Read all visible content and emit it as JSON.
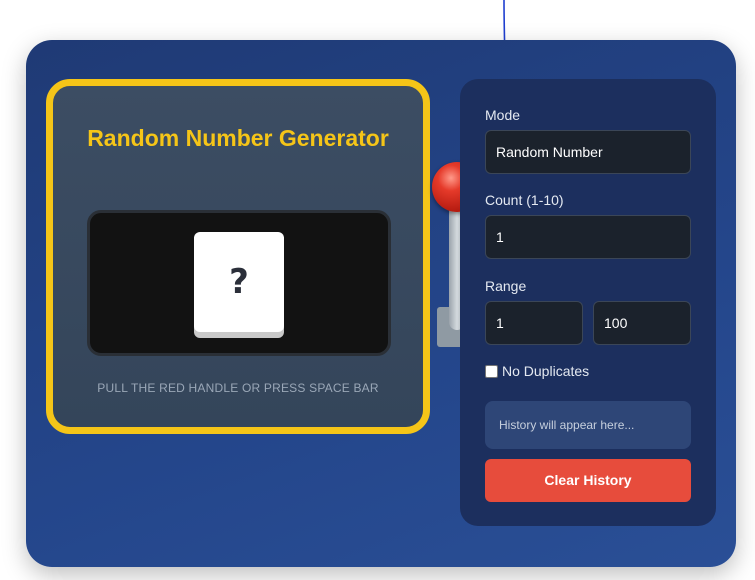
{
  "machine": {
    "title": "Random Number Generator",
    "result": "?",
    "hint": "PULL THE RED HANDLE OR PRESS SPACE BAR"
  },
  "controls": {
    "mode_label": "Mode",
    "mode_value": "Random Number",
    "count_label": "Count (1-10)",
    "count_value": "1",
    "range_label": "Range",
    "range_min": "1",
    "range_max": "100",
    "no_duplicates_label": "No Duplicates",
    "no_duplicates_checked": false,
    "history_placeholder": "History will appear here...",
    "clear_history_label": "Clear History"
  },
  "colors": {
    "frame_accent": "#f5c518",
    "panel_bg": "#1c2f5e",
    "outer_bg": "#24468b",
    "button_red": "#e74c3c",
    "knob_red": "#e53a2a"
  },
  "icons": {
    "lever": "lever-knob-icon",
    "annotation": "hand-drawn-arrow-icon"
  }
}
